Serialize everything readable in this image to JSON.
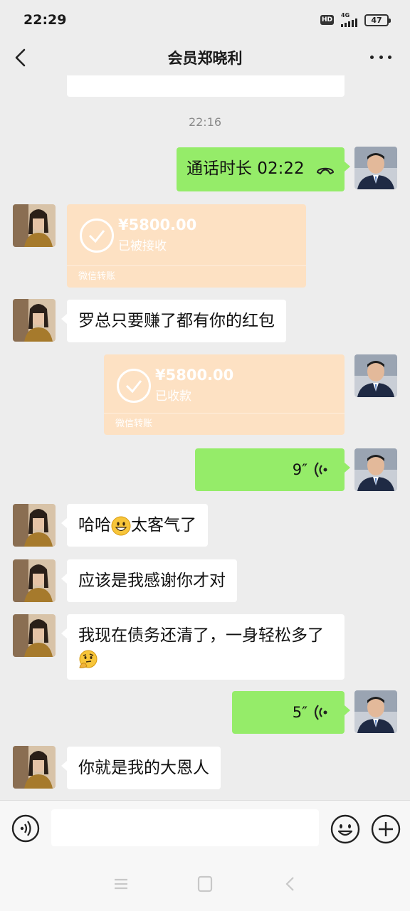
{
  "status_bar": {
    "time": "22:29",
    "hd": "HD",
    "network": "4G",
    "battery": "47"
  },
  "header": {
    "title": "会员郑晓利",
    "back_icon": "chevron-left-icon",
    "more_icon": "more-dots-icon"
  },
  "chat": {
    "timestamp": "22:16",
    "call_record": {
      "text": "通话时长 02:22",
      "icon": "phone-hangup-icon"
    },
    "transfer_1": {
      "amount": "¥5800.00",
      "status": "已被接收",
      "footer": "微信转账"
    },
    "msg_1": "罗总只要赚了都有你的红包",
    "transfer_2": {
      "amount": "¥5800.00",
      "status": "已收款",
      "footer": "微信转账"
    },
    "voice_1": {
      "duration": "9″"
    },
    "msg_2_a": "哈哈",
    "msg_2_b": "太客气了",
    "msg_3": "应该是我感谢你才对",
    "msg_4": "我现在债务还清了，一身轻松多了",
    "voice_2": {
      "duration": "5″"
    },
    "msg_5": "你就是我的大恩人"
  },
  "input_bar": {
    "value": "",
    "voice_icon": "voice-input-icon",
    "emoji_icon": "emoji-icon",
    "plus_icon": "plus-icon"
  },
  "colors": {
    "green_bubble": "#95ec69",
    "transfer_bg": "#fde1c3",
    "background": "#ededed"
  }
}
